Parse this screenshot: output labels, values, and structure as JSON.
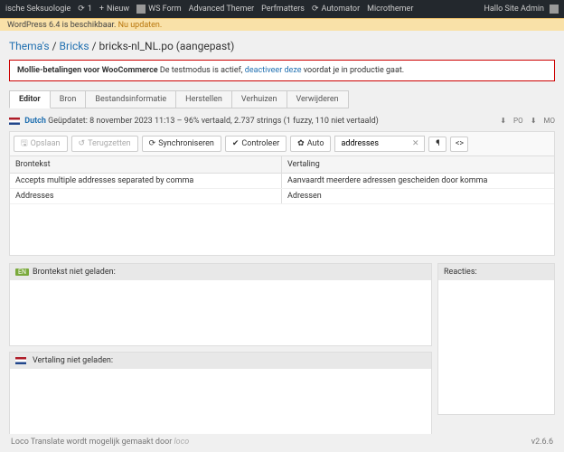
{
  "adminbar": {
    "site": "ische Seksuologie",
    "updates_count": "1",
    "new_label": "Nieuw",
    "wsform": "WS Form",
    "advanced_themer": "Advanced Themer",
    "perfmatters": "Perfmatters",
    "automator": "Automator",
    "microthemer": "Microthemer",
    "greeting": "Hallo Site Admin"
  },
  "update_banner": {
    "prefix": "WordPress 6.4",
    "text": " is beschikbaar. ",
    "link": "Nu updaten."
  },
  "breadcrumb": {
    "lvl1": "Thema's",
    "lvl2": "Bricks",
    "current": "bricks-nl_NL.po (aangepast)"
  },
  "notice": {
    "bold": "Mollie-betalingen voor WooCommerce",
    "text1": " De testmodus is actief, ",
    "link": "deactiveer deze",
    "text2": " voordat je in productie gaat."
  },
  "tabs": {
    "editor": "Editor",
    "bron": "Bron",
    "bestandsinfo": "Bestandsinformatie",
    "herstellen": "Herstellen",
    "verhuizen": "Verhuizen",
    "verwijderen": "Verwijderen"
  },
  "meta": {
    "lang": "Dutch",
    "updated": "Geüpdatet: 8 november 2023 11:13 – 96% vertaald, 2.737 strings (1 fuzzy, 110 niet vertaald)",
    "po": "PO",
    "mo": "MO"
  },
  "toolbar": {
    "opslaan": "Opslaan",
    "terugzetten": "Terugzetten",
    "sync": "Synchroniseren",
    "controleer": "Controleer",
    "auto": "Auto",
    "search_value": "addresses"
  },
  "table": {
    "head_src": "Brontekst",
    "head_tr": "Vertaling",
    "rows": [
      {
        "src": "Accepts multiple addresses separated by comma",
        "tr": "Aanvaardt meerdere adressen gescheiden door komma"
      },
      {
        "src": "Addresses",
        "tr": "Adressen"
      }
    ]
  },
  "panels": {
    "src_not_loaded": "Brontekst niet geladen:",
    "tr_not_loaded": "Vertaling niet geladen:",
    "reactions": "Reacties:"
  },
  "footer": {
    "text": "Loco Translate wordt mogelijk gemaakt door ",
    "brand": "loco",
    "version": "v2.6.6"
  }
}
